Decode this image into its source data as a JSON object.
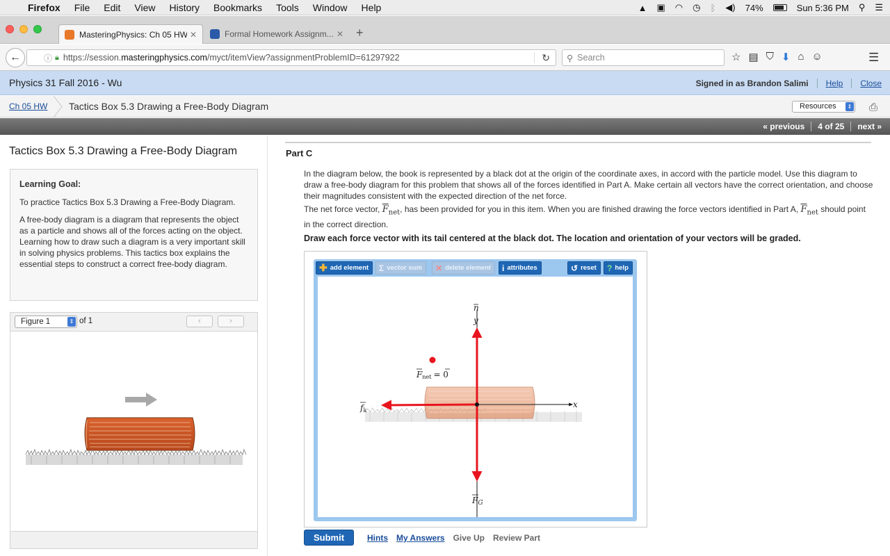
{
  "os_menubar": {
    "apple_icon": "apple-icon",
    "app": "Firefox",
    "items": [
      "File",
      "Edit",
      "View",
      "History",
      "Bookmarks",
      "Tools",
      "Window",
      "Help"
    ],
    "battery": "74%",
    "clock": "Sun 5:36 PM"
  },
  "browser": {
    "tabs": [
      {
        "label": "MasteringPhysics: Ch 05 HW",
        "close": "✕",
        "active": true
      },
      {
        "label": "Formal Homework Assignm...",
        "close": "✕",
        "active": false
      }
    ],
    "new_tab": "+",
    "url_host": "https://session.",
    "url_domain": "masteringphysics.com",
    "url_path": "/myct/itemView?assignmentProblemID=61297922",
    "search_placeholder": "Search"
  },
  "course": {
    "title": "Physics 31 Fall 2016 - Wu",
    "signed_in": "Signed in as Brandon Salimi",
    "help": "Help",
    "close": "Close"
  },
  "breadcrumb": {
    "link": "Ch 05 HW",
    "current": "Tactics Box 5.3 Drawing a Free-Body Diagram",
    "resources": "Resources"
  },
  "pager": {
    "previous": "« previous",
    "position": "4 of 25",
    "next": "next »"
  },
  "left": {
    "title": "Tactics Box 5.3 Drawing a Free-Body Diagram",
    "goal_heading": "Learning Goal:",
    "goal_p1": "To practice Tactics Box 5.3 Drawing a Free-Body Diagram.",
    "goal_p2": "A free-body diagram is a diagram that represents the object as a particle and shows all of the forces acting on the object. Learning how to draw such a diagram is a very important skill in solving physics problems. This tactics box explains the essential steps to construct a correct free-body diagram.",
    "figure_select": "Figure 1",
    "figure_of": "of 1",
    "prev_arrow": "‹",
    "next_arrow": "›"
  },
  "part": {
    "title": "Part C",
    "p1": "In the diagram below, the book is represented by a black dot at the origin of the coordinate axes, in accord with the particle model. Use this diagram to draw a free-body diagram for this problem that shows all of the forces identified in Part A. Make certain all vectors have the correct orientation, and choose their magnitudes consistent with the expected direction of the net force.",
    "p2_a": "The net force vector, ",
    "p2_b": ", has been provided for you in this item. When you are finished drawing the force vectors identified in Part A, ",
    "p2_c": " should point in the correct direction.",
    "fnet_symbol": "F",
    "fnet_sub": "net",
    "bold": "Draw each force vector with its tail centered at the black dot. The location and orientation of your vectors will be graded."
  },
  "tool": {
    "add_element": "add element",
    "vector_sum": "vector sum",
    "delete_element": "delete element",
    "attributes": "attributes",
    "reset": "reset",
    "help": "help",
    "label_n": "n",
    "label_y": "y",
    "label_x": "x",
    "label_fk": "f",
    "label_fk_sub": "k",
    "label_fg": "F",
    "label_fg_sub": "G",
    "label_fnet": "F",
    "label_fnet_sub": "net",
    "label_fnet_eq": "= 0",
    "colors": {
      "vector": "#e8141e",
      "book": "#e2845a",
      "panel": "#9cc7ef",
      "button": "#1f67b5"
    }
  },
  "actions": {
    "submit": "Submit",
    "hints": "Hints",
    "my_answers": "My Answers",
    "give_up": "Give Up",
    "review_part": "Review Part"
  }
}
